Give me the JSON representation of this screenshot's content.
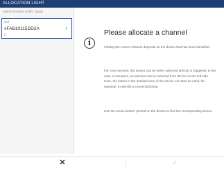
{
  "window": {
    "title": "ALLOCATION LIGHT"
  },
  "sidebar": {
    "header": "Switch actuator lockhr 1gang",
    "items": [
      {
        "type": "i20f",
        "serial": "#FAB10115DD2A",
        "sub": "g",
        "chevron": "›"
      }
    ]
  },
  "main": {
    "info_icon": "i",
    "heading": "Please allocate a channel",
    "paragraphs": [
      "Finding the correct channel depends on the device that has been identified.",
      "For most sensors, the sensor can be either switched directly or triggered. In the case of actuators, an element can be selected from the list on the left side. Here, the button in the detailed view of the device can then be used, for example, to identify a connected lamp.",
      "Use the serial number printed on the device to find the corresponding device."
    ]
  },
  "footer": {
    "cancel_icon": "✕",
    "confirm_icon": "✓"
  },
  "colors": {
    "titlebar": "#1d3f73",
    "selection_border": "#2b5aa6",
    "confirm_disabled": "#cfcfcf"
  }
}
